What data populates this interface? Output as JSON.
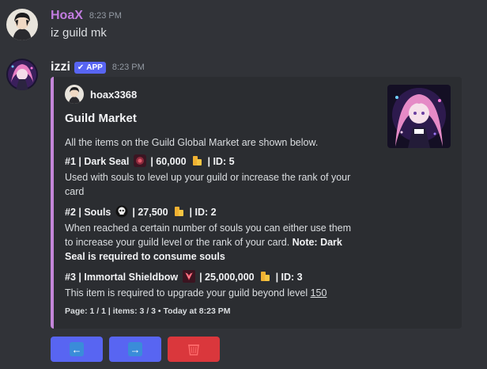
{
  "messages": [
    {
      "author": "HoaX",
      "author_color": "#c27ce0",
      "timestamp": "8:23 PM",
      "content": "iz guild mk"
    },
    {
      "author": "izzi",
      "author_color": "#f2f3f5",
      "badge": "APP",
      "timestamp": "8:23 PM"
    }
  ],
  "embed": {
    "accent_color": "#c486d9",
    "author_name": "hoax3368",
    "title": "Guild Market",
    "intro": "All the items on the Guild Global Market are shown below.",
    "items": [
      {
        "header_prefix": "#1 | Dark Seal",
        "icon": "dark-seal-icon",
        "header_suffix": "| 60,000",
        "currency_icon": "gold-coins-icon",
        "id_text": "| ID: 5",
        "desc_line1": "Used with souls to level up your guild or increase the rank of your",
        "desc_line2": "card"
      },
      {
        "header_prefix": "#2 | Souls",
        "icon": "skull-soul-icon",
        "header_suffix": "| 27,500",
        "currency_icon": "gold-coins-icon",
        "id_text": "| ID: 2",
        "desc_line1": "When reached a certain number of souls you can either use them",
        "desc_line2a": "to increase your guild level or the rank of your card. ",
        "desc_line2b": "Note: Dark",
        "desc_line3": "Seal is required to consume souls"
      },
      {
        "header_prefix": "#3 | Immortal Shieldbow",
        "icon": "shieldbow-icon",
        "header_suffix": "| 25,000,000",
        "currency_icon": "gold-coins-icon",
        "id_text": "| ID: 3",
        "desc_text": "This item is required to upgrade your guild beyond level ",
        "desc_link": "150"
      }
    ],
    "footer": "Page: 1 / 1 | items: 3 / 3 • Today at 8:23 PM"
  },
  "buttons": [
    {
      "label": "←",
      "icon": "arrow-left-icon",
      "color": "#5865f2"
    },
    {
      "label": "→",
      "icon": "arrow-right-icon",
      "color": "#5865f2"
    },
    {
      "label": "",
      "icon": "wastebasket-icon",
      "color": "#da373c"
    }
  ]
}
